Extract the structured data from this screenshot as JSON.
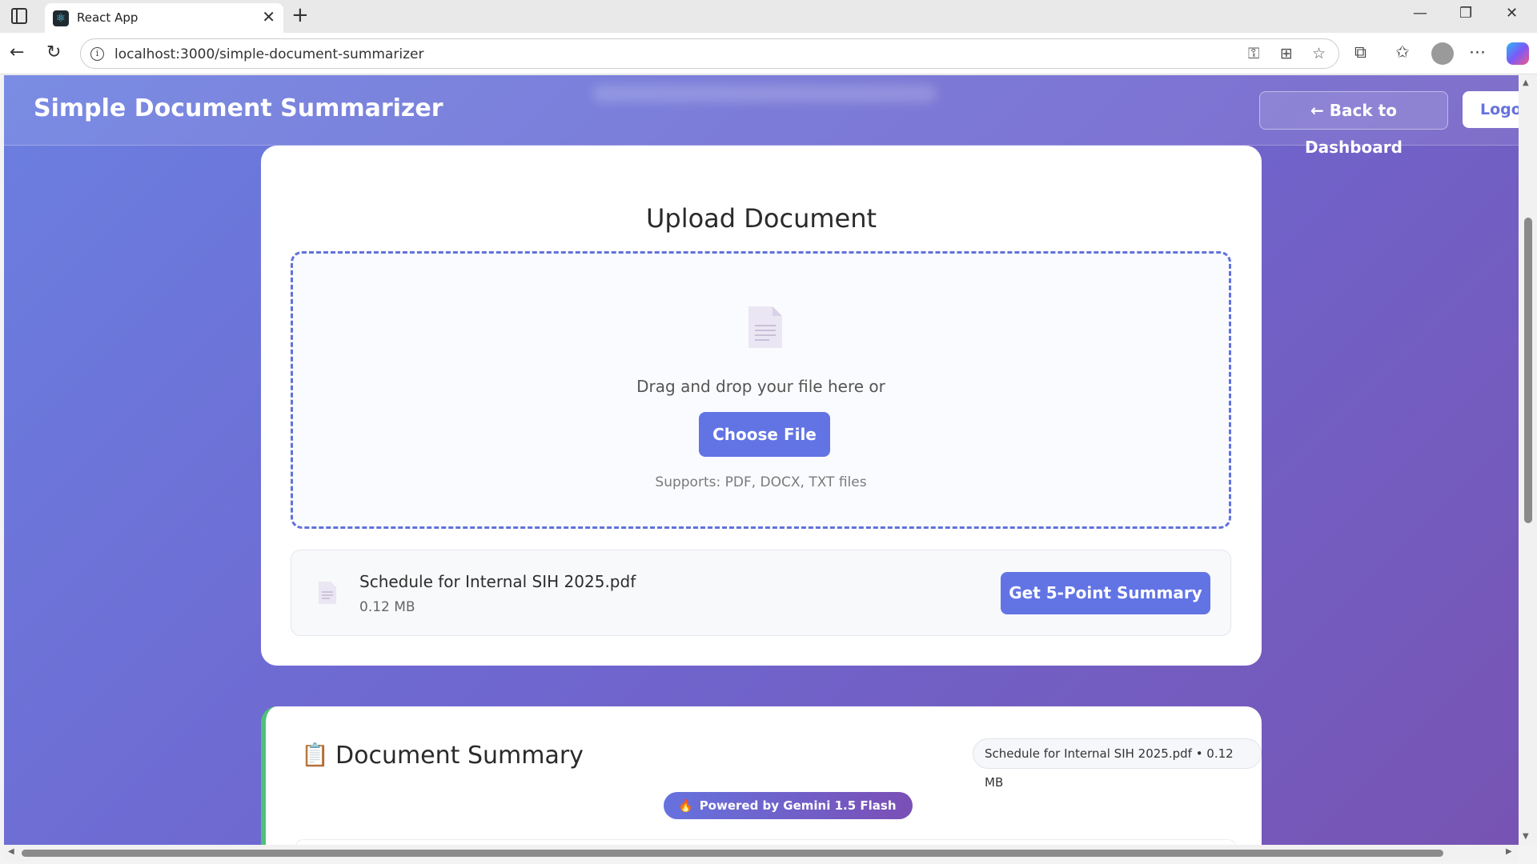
{
  "browser": {
    "tab_title": "React App",
    "tab_favicon": "⚛",
    "new_tab_glyph": "+",
    "tab_close_glyph": "✕",
    "url": "localhost:3000/simple-document-summarizer",
    "window_controls": {
      "minimize": "—",
      "restore": "❐",
      "close": "✕"
    },
    "nav": {
      "back": "←",
      "reload": "↻"
    },
    "url_actions": {
      "key": "⚿",
      "apps": "⊞",
      "favorite": "☆"
    },
    "toolbar": {
      "extensions": "⧉",
      "favorites": "✩",
      "more": "⋯"
    }
  },
  "header": {
    "title": "Simple Document Summarizer",
    "back_label": "← Back to Dashboard",
    "logout_label": "Logout"
  },
  "upload": {
    "heading": "Upload Document",
    "drop_text": "Drag and drop your file here or",
    "choose_label": "Choose File",
    "supports": "Supports: PDF, DOCX, TXT files"
  },
  "file": {
    "name": "Schedule for Internal SIH 2025.pdf",
    "size": "0.12 MB",
    "action_label": "Get 5-Point Summary"
  },
  "summary": {
    "icon": "📋",
    "heading": "Document Summary",
    "badge": "Schedule for Internal SIH 2025.pdf • 0.12 MB",
    "powered_spark": "🔥",
    "powered_label": "Powered by Gemini 1.5 Flash"
  },
  "colors": {
    "accent": "#6274e4",
    "success_border": "#4fc07a",
    "gradient_start": "#6b7fe0",
    "gradient_end": "#7754b3"
  }
}
